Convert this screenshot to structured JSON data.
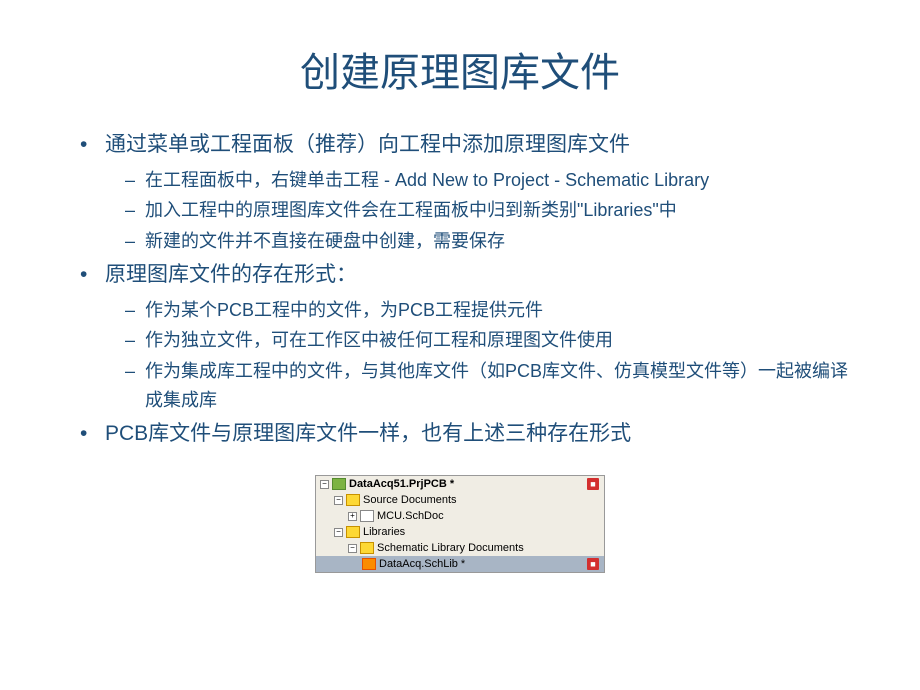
{
  "title": "创建原理图库文件",
  "bullets": {
    "b1": "通过菜单或工程面板（推荐）向工程中添加原理图库文件",
    "b1_1": "在工程面板中，右键单击工程 - Add New to Project - Schematic Library",
    "b1_2": "加入工程中的原理图库文件会在工程面板中归到新类别\"Libraries\"中",
    "b1_3": "新建的文件并不直接在硬盘中创建，需要保存",
    "b2": "原理图库文件的存在形式：",
    "b2_1": "作为某个PCB工程中的文件，为PCB工程提供元件",
    "b2_2": "作为独立文件，可在工作区中被任何工程和原理图文件使用",
    "b2_3": "作为集成库工程中的文件，与其他库文件（如PCB库文件、仿真模型文件等）一起被编译成集成库",
    "b3": "PCB库文件与原理图库文件一样，也有上述三种存在形式"
  },
  "tree": {
    "root": "DataAcq51.PrjPCB *",
    "node1": "Source Documents",
    "node1_1": "MCU.SchDoc",
    "node2": "Libraries",
    "node2_1": "Schematic Library Documents",
    "node2_1_1": "DataAcq.SchLib *",
    "collapse_minus": "−",
    "collapse_plus": "+"
  }
}
